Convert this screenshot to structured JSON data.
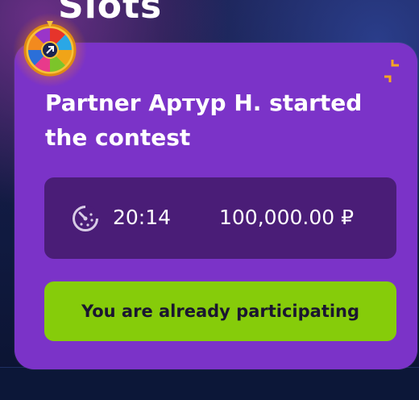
{
  "page": {
    "section_title": "Slots"
  },
  "contest": {
    "heading": "Partner Артур Н. started the contest",
    "timer": "20:14",
    "amount": "100,000.00 ₽",
    "action_label": "You are already participating"
  },
  "icons": {
    "timer": "timer-icon",
    "expand": "expand-icon",
    "wheel": "fortune-wheel-icon"
  },
  "colors": {
    "card": "#7b33c8",
    "info_box": "#4a1d77",
    "button": "#86cc0a",
    "accent_orange": "#f5a623"
  }
}
